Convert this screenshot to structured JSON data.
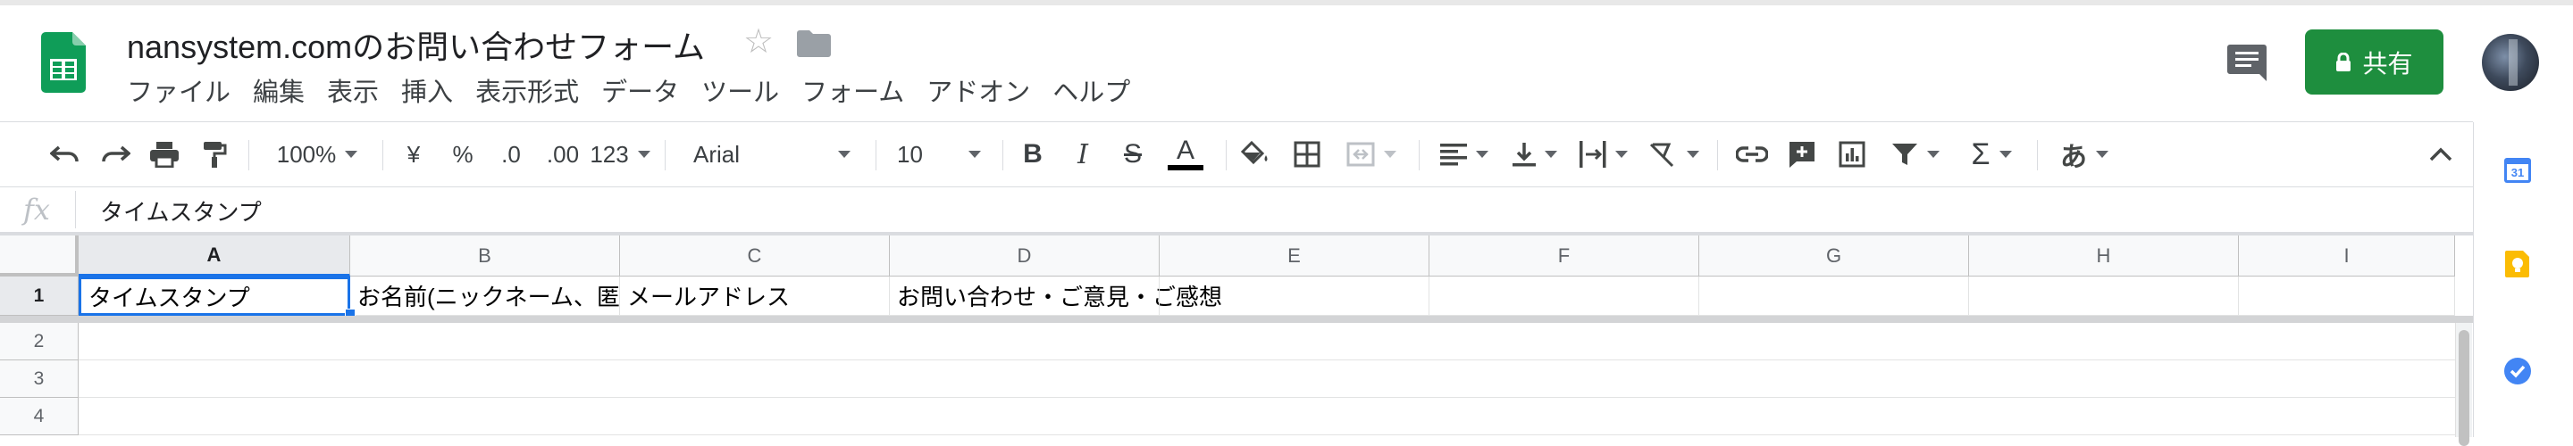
{
  "document": {
    "title": "nansystem.comのお問い合わせフォーム"
  },
  "menu": {
    "items": [
      "ファイル",
      "編集",
      "表示",
      "挿入",
      "表示形式",
      "データ",
      "ツール",
      "フォーム",
      "アドオン",
      "ヘルプ"
    ]
  },
  "share_button": {
    "label": "共有"
  },
  "toolbar": {
    "zoom": "100%",
    "currency": "¥",
    "percent": "%",
    "decrease_decimal": ".0",
    "increase_decimal": ".00",
    "more_formats": "123",
    "font_family": "Arial",
    "font_size": "10",
    "bold": "B",
    "italic": "I",
    "strikethrough": "S",
    "text_color": "A",
    "input_tools": "あ"
  },
  "formula_bar": {
    "fx_label": "fx",
    "value": "タイムスタンプ"
  },
  "grid": {
    "columns": [
      "A",
      "B",
      "C",
      "D",
      "E",
      "F",
      "G",
      "H",
      "I"
    ],
    "rows": [
      "1",
      "2",
      "3",
      "4"
    ],
    "cells": {
      "A1": "タイムスタンプ",
      "B1": "お名前(ニックネーム、匿",
      "C1": "メールアドレス",
      "D1": "お問い合わせ・ご意見・ご感想"
    }
  },
  "colors": {
    "share_green": "#1e8e3e",
    "selection_blue": "#1a73e8",
    "sheets_green": "#0f9d58"
  }
}
